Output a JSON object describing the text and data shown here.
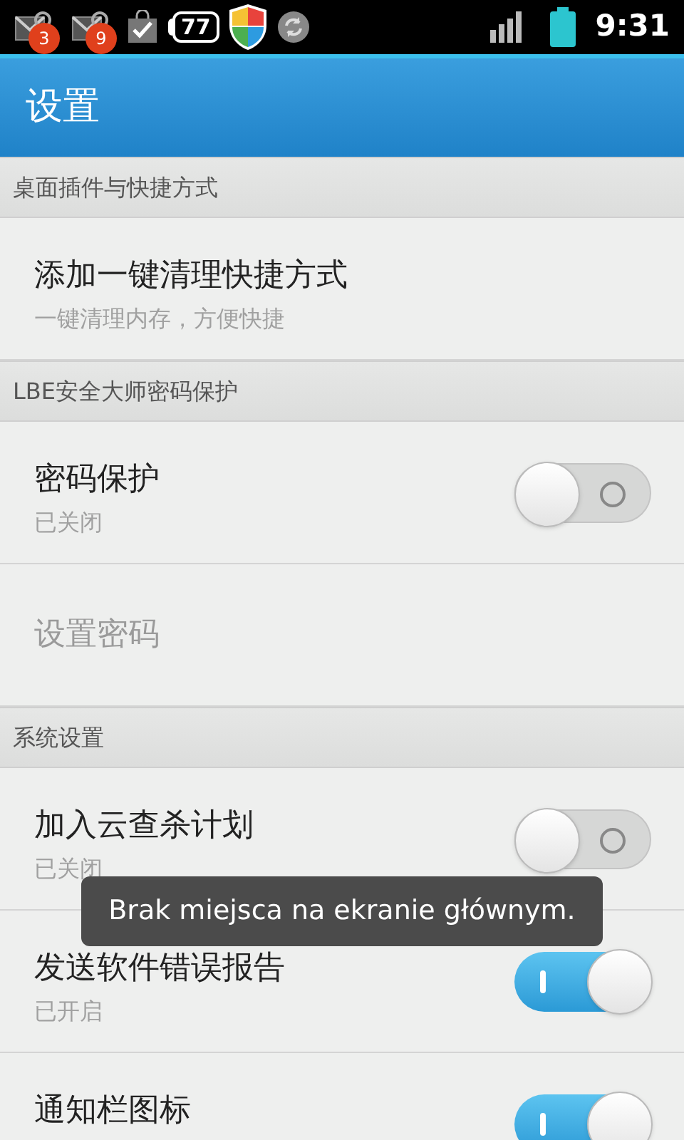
{
  "status_bar": {
    "notifications": [
      {
        "kind": "mail",
        "badge": "3"
      },
      {
        "kind": "mail",
        "badge": "9"
      },
      {
        "kind": "bag"
      },
      {
        "kind": "battery-text",
        "text": "77"
      },
      {
        "kind": "shield"
      },
      {
        "kind": "sync"
      }
    ],
    "time": "9:31"
  },
  "app_bar": {
    "title": "设置"
  },
  "sections": [
    {
      "title": "桌面插件与快捷方式",
      "items": [
        {
          "kind": "plain",
          "title": "添加一键清理快捷方式",
          "subtitle": "一键清理内存，方便快捷",
          "disabled": false
        }
      ]
    },
    {
      "title": "LBE安全大师密码保护",
      "items": [
        {
          "kind": "toggle",
          "title": "密码保护",
          "subtitle": "已关闭",
          "on": false
        },
        {
          "kind": "plain",
          "title": "设置密码",
          "disabled": true
        }
      ]
    },
    {
      "title": "系统设置",
      "items": [
        {
          "kind": "toggle",
          "title": "加入云查杀计划",
          "subtitle": "已关闭",
          "on": false
        },
        {
          "kind": "toggle",
          "title": "发送软件错误报告",
          "subtitle": "已开启",
          "on": true
        },
        {
          "kind": "toggle",
          "title": "通知栏图标",
          "on": true
        }
      ]
    }
  ],
  "toast": "Brak miejsca na ekranie głównym."
}
